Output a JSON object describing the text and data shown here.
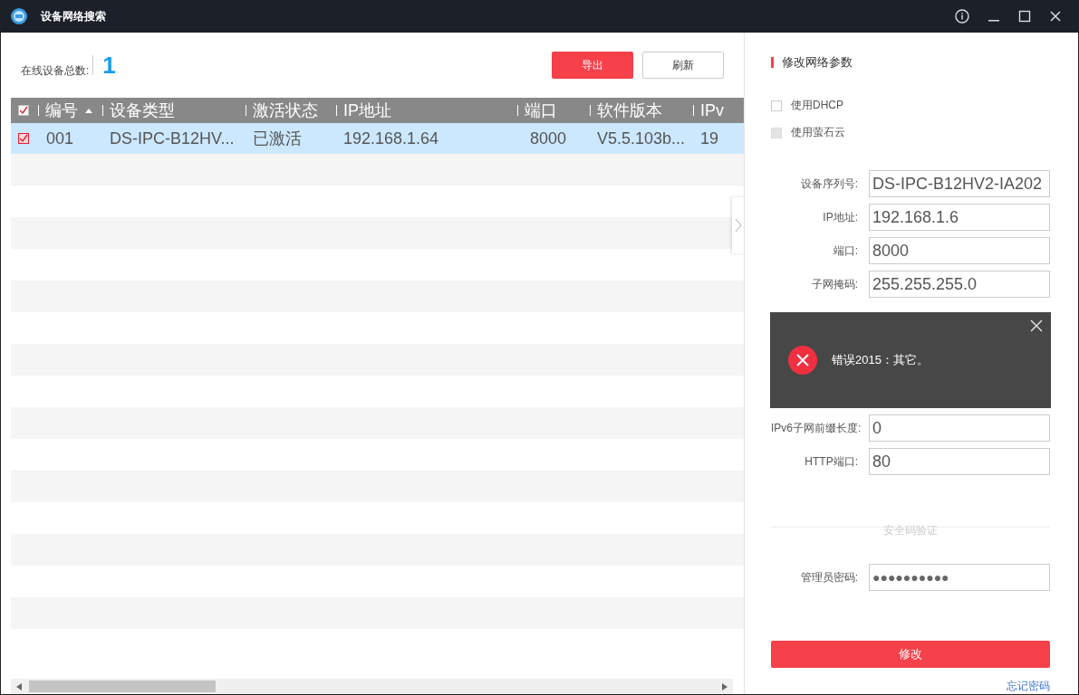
{
  "window": {
    "title": "设备网络搜索"
  },
  "summary": {
    "label": "在线设备总数:",
    "count": "1"
  },
  "toolbar": {
    "buttons": [
      {
        "label": "导出",
        "kind": "primary"
      },
      {
        "label": "刷新",
        "kind": "secondary"
      }
    ]
  },
  "table": {
    "header_checked": true,
    "columns": [
      {
        "label": "编号",
        "sorted": true
      },
      {
        "label": "设备类型",
        "sorted": false
      },
      {
        "label": "激活状态",
        "sorted": false
      },
      {
        "label": "IP地址",
        "sorted": false
      },
      {
        "label": "端口",
        "sorted": false
      },
      {
        "label": "软件版本",
        "sorted": false
      },
      {
        "label": "IPv",
        "sorted": false
      }
    ],
    "rows": [
      {
        "selected": true,
        "checked": true,
        "cells": [
          "001",
          "DS-IPC-B12HV...",
          "已激活",
          "192.168.1.64",
          "8000",
          "V5.5.103b...",
          "19"
        ]
      }
    ]
  },
  "panel": {
    "title": "修改网络参数",
    "options": [
      {
        "label": "使用DHCP",
        "checked": false,
        "disabled": false
      },
      {
        "label": "使用萤石云",
        "checked": false,
        "disabled": true
      }
    ],
    "fields": [
      {
        "label": "设备序列号:",
        "value": "DS-IPC-B12HV2-IA202"
      },
      {
        "label": "IP地址:",
        "value": "192.168.1.6"
      },
      {
        "label": "端口:",
        "value": "8000"
      },
      {
        "label": "子网掩码:",
        "value": "255.255.255.0"
      }
    ],
    "fields_below": [
      {
        "label": "IPv6子网前缀长度:",
        "value": "0"
      },
      {
        "label": "HTTP端口:",
        "value": "80"
      }
    ],
    "section": "安全码验证",
    "password": {
      "label": "管理员密码:",
      "value": "●●●●●●●●●●"
    },
    "submit": "修改",
    "link": "忘记密码"
  },
  "toast": {
    "kind": "error",
    "message": "错误2015：其它。"
  }
}
